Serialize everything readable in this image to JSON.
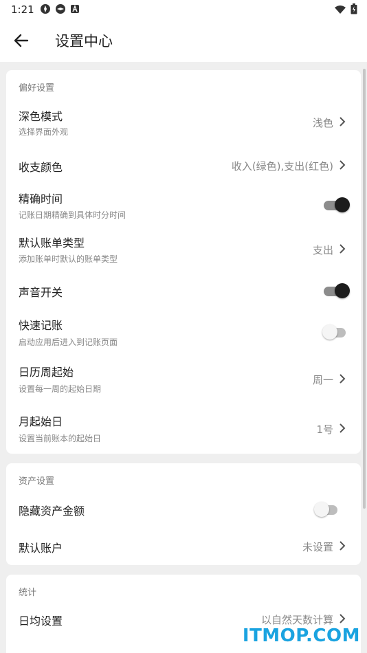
{
  "status_bar": {
    "time": "1:21"
  },
  "header": {
    "title": "设置中心"
  },
  "sections": [
    {
      "title": "偏好设置",
      "items": [
        {
          "title": "深色模式",
          "subtitle": "选择界面外观",
          "value": "浅色"
        },
        {
          "title": "收支颜色",
          "value": "收入(绿色),支出(红色)"
        },
        {
          "title": "精确时间",
          "subtitle": "记账日期精确到具体时分时间",
          "toggle": true
        },
        {
          "title": "默认账单类型",
          "subtitle": "添加账单时默认的账单类型",
          "value": "支出"
        },
        {
          "title": "声音开关",
          "toggle": true
        },
        {
          "title": "快速记账",
          "subtitle": "启动应用后进入到记账页面",
          "toggle": false
        },
        {
          "title": "日历周起始",
          "subtitle": "设置每一周的起始日期",
          "value": "周一"
        },
        {
          "title": "月起始日",
          "subtitle": "设置当前账本的起始日",
          "value": "1号"
        }
      ]
    },
    {
      "title": "资产设置",
      "items": [
        {
          "title": "隐藏资产金额",
          "toggle": false
        },
        {
          "title": "默认账户",
          "value": "未设置"
        }
      ]
    },
    {
      "title": "统计",
      "items": [
        {
          "title": "日均设置",
          "value": "以自然天数计算"
        }
      ]
    }
  ],
  "watermark": "ITMOP.COM"
}
